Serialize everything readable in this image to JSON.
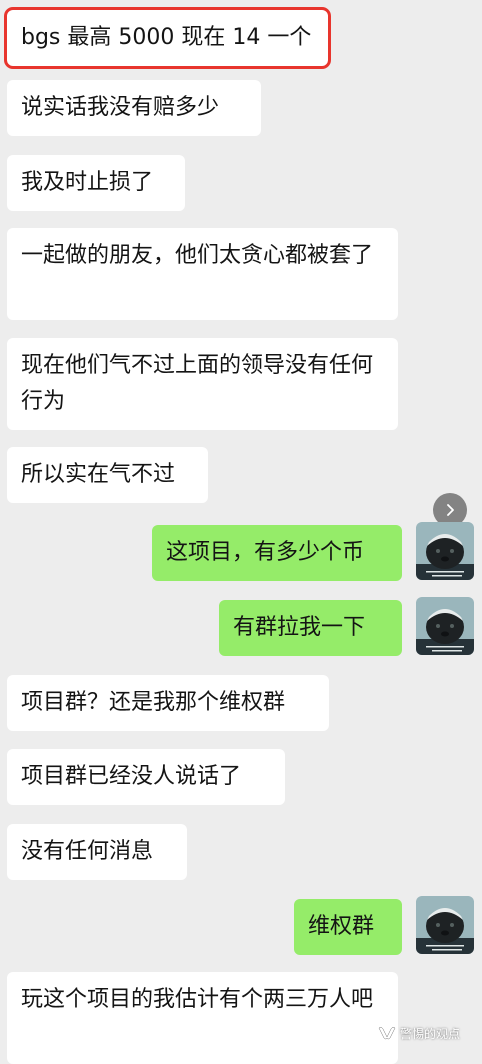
{
  "messages": [
    {
      "side": "in",
      "text": "bgs 最高 5000 现在 14 一个",
      "highlighted": true
    },
    {
      "side": "in",
      "text": "说实话我没有赔多少"
    },
    {
      "side": "in",
      "text": "我及时止损了"
    },
    {
      "side": "in",
      "text": "一起做的朋友，他们太贪心都被套了"
    },
    {
      "side": "in",
      "text": "现在他们气不过上面的领导没有任何行为"
    },
    {
      "side": "in",
      "text": "所以实在气不过"
    },
    {
      "side": "out",
      "text": "这项目，有多少个币"
    },
    {
      "side": "out",
      "text": "有群拉我一下"
    },
    {
      "side": "in",
      "text": "项目群？还是我那个维权群"
    },
    {
      "side": "in",
      "text": "项目群已经没人说话了"
    },
    {
      "side": "in",
      "text": "没有任何消息"
    },
    {
      "side": "out",
      "text": "维权群"
    },
    {
      "side": "in",
      "text": "玩这个项目的我估计有个两三万人吧"
    }
  ],
  "avatar": {
    "icon": "honey-badger-avatar-icon"
  },
  "watermark": {
    "icon": "wechat-channel-icon",
    "text": "警惕的观点"
  },
  "colors": {
    "background": "#ededed",
    "incoming": "#ffffff",
    "outgoing": "#95ec69",
    "highlight": "#e8352d"
  }
}
